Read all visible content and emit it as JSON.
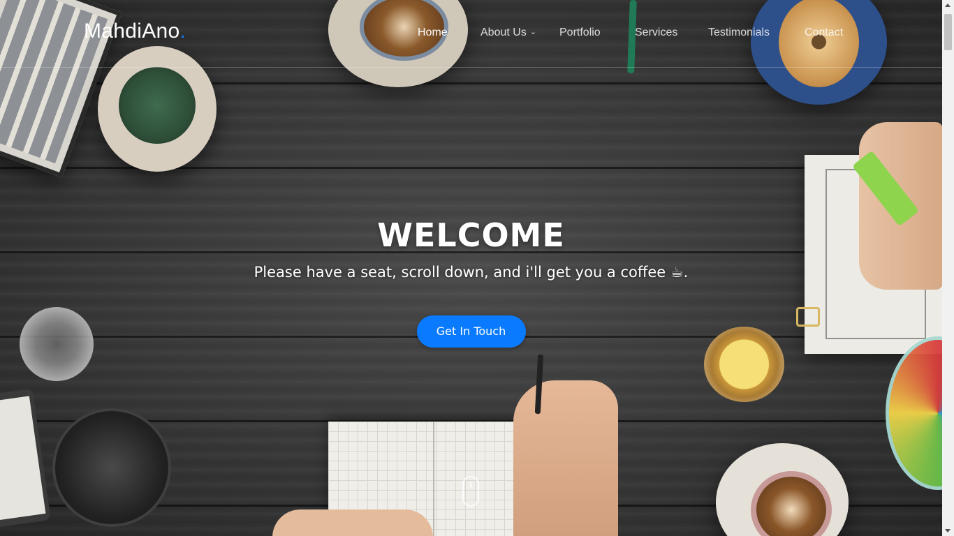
{
  "logo": {
    "text": "MahdiAno",
    "dot": "."
  },
  "nav": {
    "items": [
      {
        "label": "Home",
        "active": true
      },
      {
        "label": "About Us",
        "has_dropdown": true
      },
      {
        "label": "Portfolio"
      },
      {
        "label": "Services"
      },
      {
        "label": "Testimonials"
      },
      {
        "label": "Contact"
      }
    ]
  },
  "hero": {
    "title": "WELCOME",
    "subtitle": "Please have a seat, scroll down, and i'll get you a coffee ☕.",
    "cta_label": "Get In Touch"
  },
  "colors": {
    "accent": "#0a7bff",
    "text": "#ffffff",
    "background": "#3a3a3a"
  },
  "icons": {
    "scroll": "mouse-scroll-icon",
    "dropdown": "chevron-down-icon"
  }
}
